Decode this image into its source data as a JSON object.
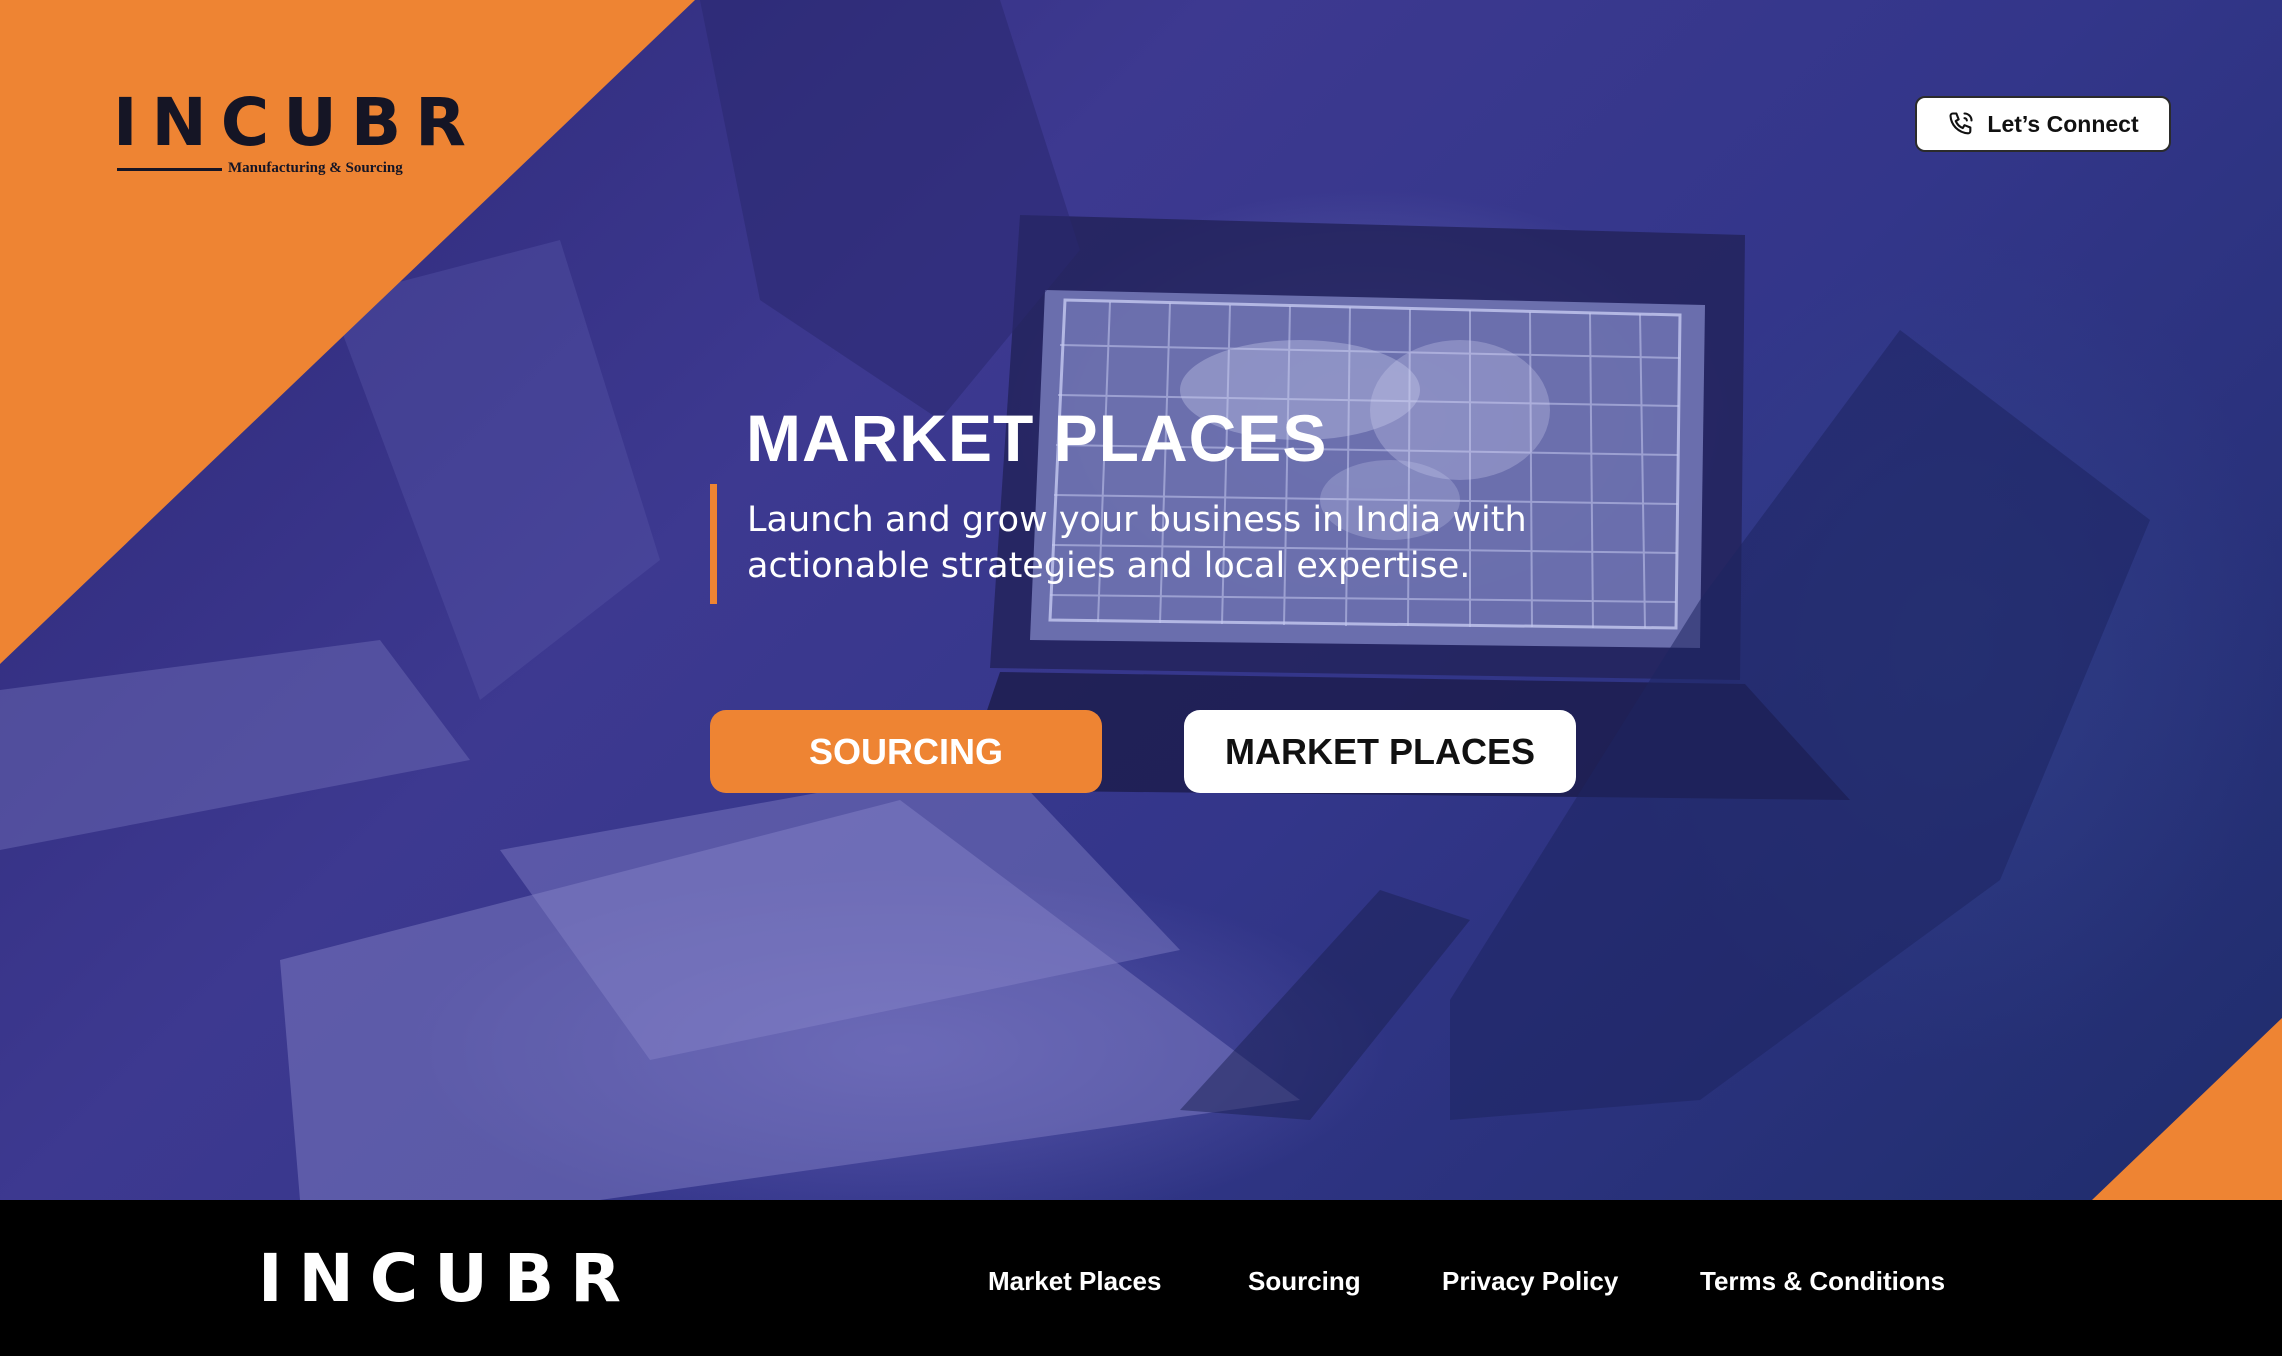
{
  "header": {
    "logo_text": "INCUBR",
    "logo_tagline": "Manufacturing & Sourcing",
    "connect_label": "Let’s Connect",
    "connect_icon": "phone-call-icon"
  },
  "hero": {
    "title": "MARKET PLACES",
    "subtitle_line1": "Launch and grow your business in India with",
    "subtitle_line2": "actionable strategies and local expertise.",
    "buttons": [
      {
        "label": "SOURCING"
      },
      {
        "label": "MARKET PLACES"
      }
    ]
  },
  "footer": {
    "logo_text": "INCUBR",
    "links": [
      {
        "label": "Market Places"
      },
      {
        "label": "Sourcing"
      },
      {
        "label": "Privacy Policy"
      },
      {
        "label": "Terms & Conditions"
      }
    ]
  },
  "colors": {
    "accent_orange": "#ee8433",
    "hero_overlay": "#3d3990",
    "footer_bg": "#000000"
  }
}
